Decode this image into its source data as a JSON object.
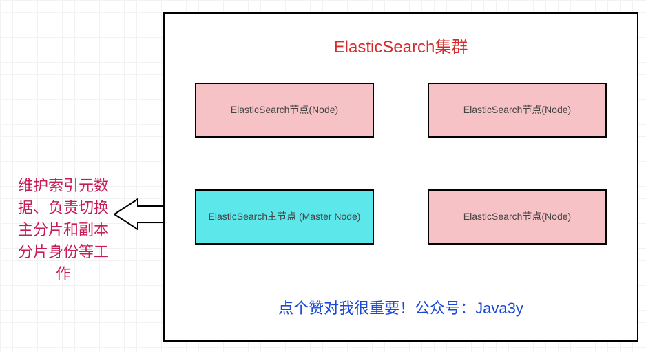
{
  "colors": {
    "title": "#d72a2a",
    "annotation": "#c81c58",
    "footer": "#1a49d6",
    "nodePink": "#f6c2c6",
    "nodeCyan": "#5ce7ea"
  },
  "cluster": {
    "title": "ElasticSearch集群",
    "nodes": [
      {
        "label": "ElasticSearch节点(Node)",
        "style": "pink"
      },
      {
        "label": "ElasticSearch节点(Node)",
        "style": "pink"
      },
      {
        "label": "ElasticSearch主节点\n(Master Node)",
        "style": "cyan"
      },
      {
        "label": "ElasticSearch节点(Node)",
        "style": "pink"
      }
    ],
    "footer": "点个赞对我很重要！公众号：Java3y"
  },
  "annotation": {
    "text": "维护索引元数据、负责切换主分片和副本分片身份等工作",
    "arrow_direction": "left",
    "points_to": "ElasticSearch主节点 (Master Node)"
  }
}
